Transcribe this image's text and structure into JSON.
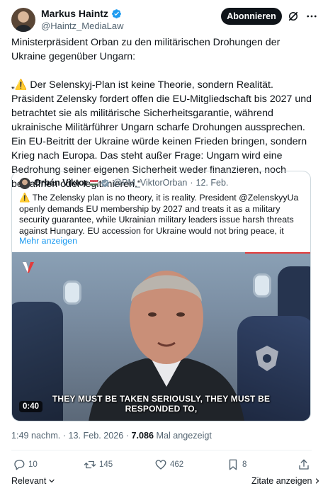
{
  "author": {
    "name": "Markus Haintz",
    "handle": "@Haintz_MediaLaw"
  },
  "header": {
    "follow_label": "Abonnieren"
  },
  "tweet": {
    "intro": "Ministerpräsident Orban zu den militärischen Drohungen der Ukraine gegenüber Ungarn:",
    "quote_open": "„",
    "warning_emoji": "⚠️",
    "body": " Der Selenskyj-Plan ist keine Theorie, sondern Realität. Präsident Zelensky fordert offen die EU-Mitgliedschaft bis 2027 und betrachtet sie als militärische Sicherheitsgarantie, während ukrainische Militärführer Ungarn scharfe Drohungen aussprechen. Ein EU-Beitritt der Ukraine würde keinen Frieden bringen, sondern Krieg nach Europa. Das steht außer Frage: Ungarn wird eine Bedrohung seiner eigenen Sicherheit weder finanzieren, noch bewaffnen oder legitimieren.“"
  },
  "quoted_tweet": {
    "name": "Orbán Viktor",
    "handle": "@PM_ViktorOrban",
    "separator": "·",
    "date": "12. Feb.",
    "warning_emoji": "⚠️",
    "text": " The Zelensky plan is no theory, it is reality. President @ZelenskyyUa openly demands EU membership by 2027 and treats it as a military security guarantee, while Ukrainian military leaders issue harsh threats against Hungary. EU accession for Ukraine would not bring peace, it",
    "show_more": "Mehr anzeigen",
    "video": {
      "caption_line1": "THEY MUST BE TAKEN SERIOUSLY, THEY MUST BE",
      "caption_line2": "RESPONDED TO,",
      "duration": "0:40"
    }
  },
  "meta": {
    "time": "1:49 nachm.",
    "separator": "·",
    "date": "13. Feb. 2026",
    "views_count": "7.086",
    "views_label": "Mal angezeigt"
  },
  "actions": {
    "replies": "10",
    "reposts": "145",
    "likes": "462",
    "bookmarks": "8"
  },
  "footer": {
    "sort_label": "Relevant",
    "quotes_label": "Zitate anzeigen"
  },
  "colors": {
    "text": "#0f1419",
    "secondary": "#536471",
    "link": "#1d9bf0",
    "verified": "#1d9bf0",
    "border": "#cfd9de"
  },
  "icons": [
    "verified-badge-icon",
    "grok-icon",
    "more-icon",
    "warning-icon",
    "reply-icon",
    "repost-icon",
    "like-icon",
    "bookmark-icon",
    "share-icon",
    "chevron-down-icon",
    "chevron-right-icon"
  ]
}
